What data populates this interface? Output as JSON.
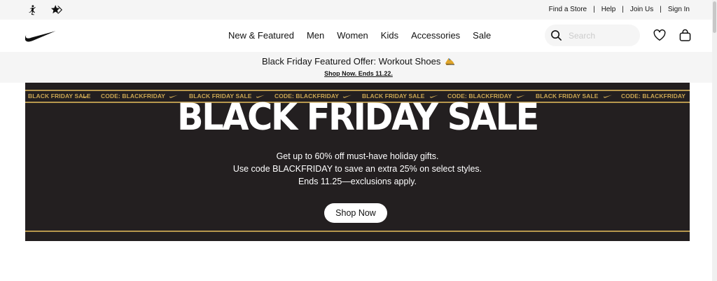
{
  "utility_bar": {
    "brand_icons": [
      "jordan-jumpman-icon",
      "converse-star-chevron-icon"
    ],
    "links": [
      "Find a Store",
      "Help",
      "Join Us",
      "Sign In"
    ],
    "separator": "|"
  },
  "nav": {
    "logo": "nike-swoosh-icon",
    "items": [
      "New & Featured",
      "Men",
      "Women",
      "Kids",
      "Accessories",
      "Sale"
    ],
    "search_placeholder": "Search",
    "icons": [
      "search-icon",
      "heart-icon",
      "bag-icon"
    ]
  },
  "promo": {
    "title": "Black Friday Featured Offer: Workout Shoes",
    "emoji": "sneaker-emoji",
    "link": "Shop Now. Ends 11.22."
  },
  "hero": {
    "ticker_items": [
      "CODE: BLACKFRIDAY",
      "BLACK FRIDAY SALE"
    ],
    "title": "BLACK FRIDAY SALE",
    "copy_lines": [
      "Get up to 60% off must-have holiday gifts.",
      "Use code BLACKFRIDAY to save an extra 25% on select styles.",
      "Ends 11.25—exclusions apply."
    ],
    "button": "Shop Now"
  },
  "colors": {
    "hero_background": "#231f20",
    "gold_accent": "#c9a552",
    "light_gray": "#f5f5f5"
  }
}
